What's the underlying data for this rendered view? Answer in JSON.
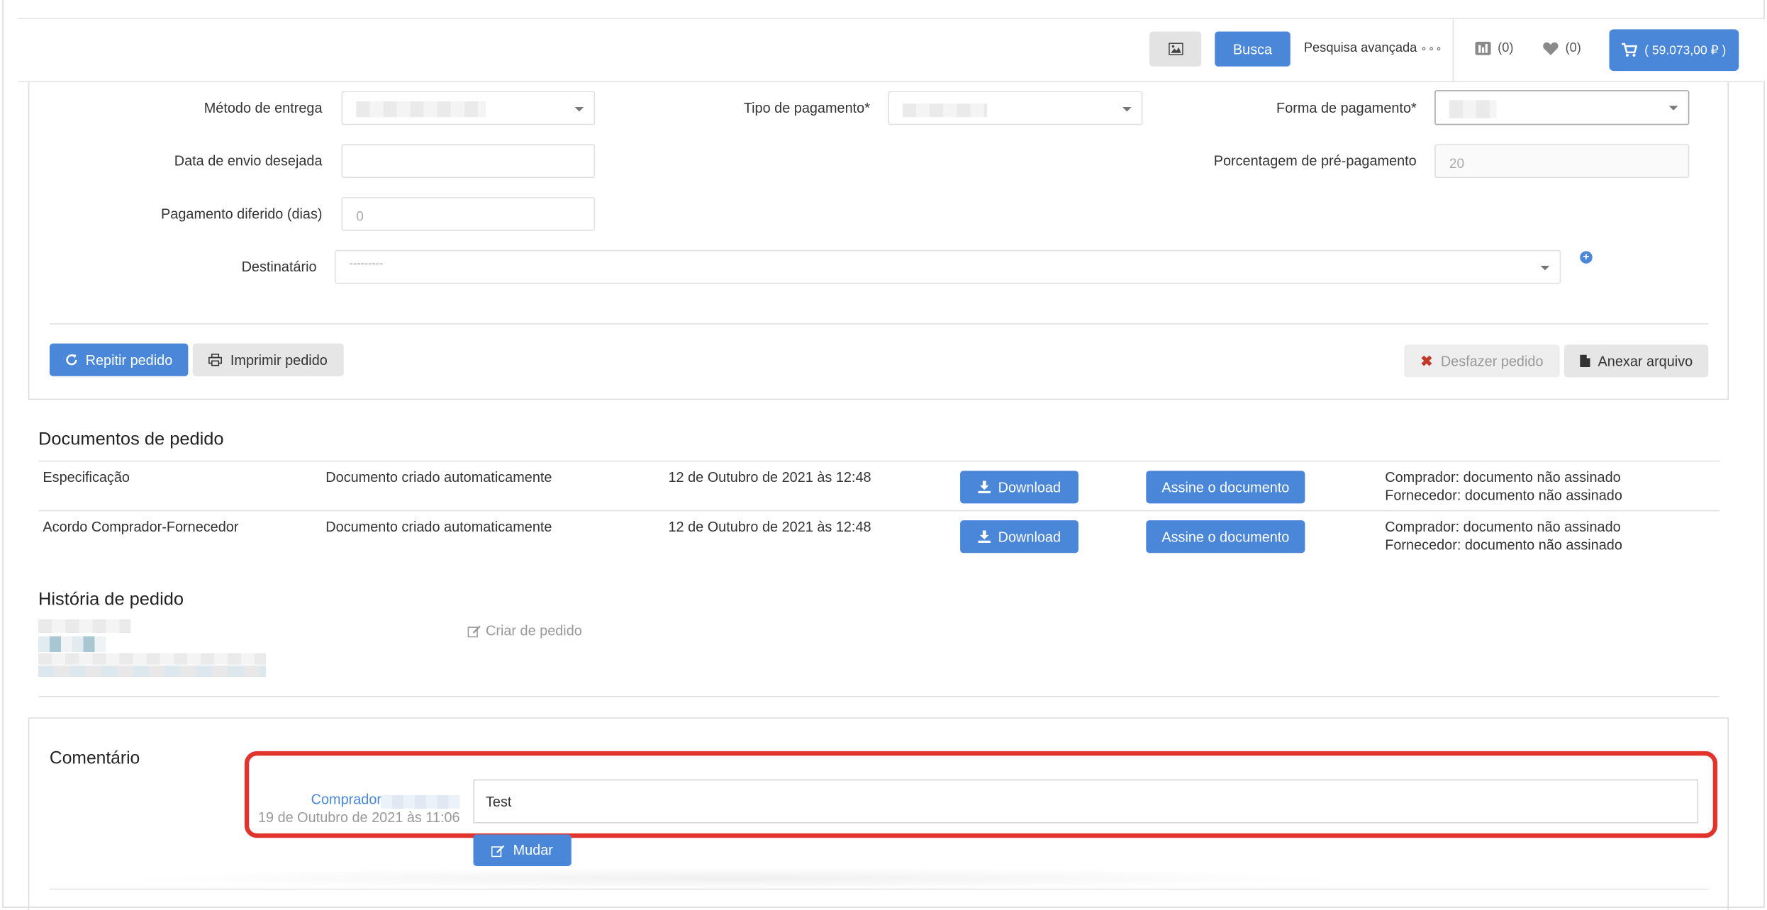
{
  "header": {
    "search_button": "Busca",
    "advanced_search": "Pesquisa avançada",
    "compare_count": "(0)",
    "favorites_count": "(0)",
    "cart_total": "( 59.073,00 ₽ )"
  },
  "order_form": {
    "delivery_method_label": "Método de entrega",
    "payment_type_label": "Tipo de pagamento*",
    "payment_form_label": "Forma de pagamento*",
    "ship_date_label": "Data de envio desejada",
    "prepayment_label": "Porcentagem de pré-pagamento",
    "prepayment_value": "20",
    "deferred_label": "Pagamento diferido (dias)",
    "deferred_value": "0",
    "recipient_label": "Destinatário",
    "recipient_value": "---------"
  },
  "actions": {
    "repeat": "Repitir pedido",
    "print": "Imprimir pedido",
    "undo": "Desfazer pedido",
    "attach": "Anexar arquivo"
  },
  "documents": {
    "title": "Documentos de pedido",
    "rows": [
      {
        "name": "Especificação",
        "origin": "Documento criado automaticamente",
        "date": "12 de Outubro de 2021 às 12:48",
        "download": "Download",
        "sign": "Assine o documento",
        "buyer_status": "Comprador: documento não assinado",
        "supplier_status": "Fornecedor: documento não assinado"
      },
      {
        "name": "Acordo Comprador-Fornecedor",
        "origin": "Documento criado automaticamente",
        "date": "12 de Outubro de 2021 às 12:48",
        "download": "Download",
        "sign": "Assine o documento",
        "buyer_status": "Comprador: documento não assinado",
        "supplier_status": "Fornecedor: documento não assinado"
      }
    ]
  },
  "history": {
    "title": "História de pedido",
    "event": "Criar de pedido"
  },
  "comment": {
    "title": "Comentário",
    "author": "Comprador",
    "date": "19 de Outubro de 2021 às 11:06",
    "text": "Test",
    "edit_button": "Mudar"
  },
  "colors": {
    "primary": "#4a87d8",
    "highlight": "#e0342c"
  },
  "icons": [
    "image-icon",
    "compare-icon",
    "heart-icon",
    "cart-icon",
    "refresh-icon",
    "print-icon",
    "times-icon",
    "file-icon",
    "download-icon",
    "edit-icon",
    "plus-circle-icon",
    "dots-icon",
    "chevron-down-icon"
  ]
}
